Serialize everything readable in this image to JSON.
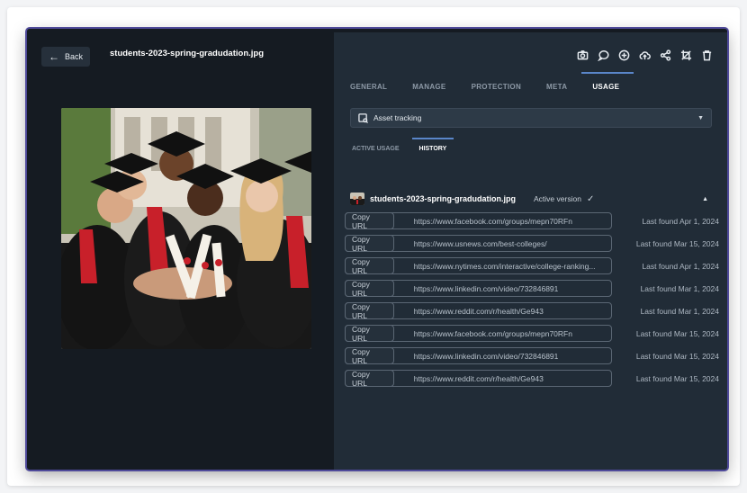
{
  "header": {
    "back_label": "Back",
    "file_name": "students-2023-spring-gradudation.jpg"
  },
  "toolbar": {
    "icons": [
      "camera-icon",
      "comment-icon",
      "add-circle-icon",
      "cloud-upload-icon",
      "share-icon",
      "crop-icon",
      "trash-icon"
    ]
  },
  "tabs": [
    {
      "label": "GENERAL",
      "active": false
    },
    {
      "label": "MANAGE",
      "active": false
    },
    {
      "label": "PROTECTION",
      "active": false
    },
    {
      "label": "META",
      "active": false
    },
    {
      "label": "USAGE",
      "active": true
    }
  ],
  "select": {
    "value": "Asset tracking"
  },
  "subtabs": [
    {
      "label": "ACTIVE USAGE",
      "active": false
    },
    {
      "label": "HISTORY",
      "active": true
    }
  ],
  "version": {
    "name": "students-2023-spring-gradudation.jpg",
    "status": "Active version"
  },
  "usage_rows": [
    {
      "copy_label": "Copy URL",
      "url": "https://www.facebook.com/groups/mepn70RFn",
      "found": "Last found Apr 1, 2024"
    },
    {
      "copy_label": "Copy URL",
      "url": "https://www.usnews.com/best-colleges/",
      "found": "Last found Mar 15, 2024"
    },
    {
      "copy_label": "Copy URL",
      "url": "https://www.nytimes.com/interactive/college-ranking...",
      "found": "Last found Apr 1, 2024"
    },
    {
      "copy_label": "Copy URL",
      "url": "https://www.linkedin.com/video/732846891",
      "found": "Last found Mar 1, 2024"
    },
    {
      "copy_label": "Copy URL",
      "url": "https://www.reddit.com/r/health/Ge943",
      "found": "Last found Mar 1, 2024"
    },
    {
      "copy_label": "Copy URL",
      "url": "https://www.facebook.com/groups/mepn70RFn",
      "found": "Last found Mar 15, 2024"
    },
    {
      "copy_label": "Copy URL",
      "url": "https://www.linkedin.com/video/732846891",
      "found": "Last found Mar 15, 2024"
    },
    {
      "copy_label": "Copy URL",
      "url": "https://www.reddit.com/r/health/Ge943",
      "found": "Last found Mar 15, 2024"
    }
  ],
  "colors": {
    "panel_dark": "#151b22",
    "panel": "#212c37",
    "accent": "#5a86c9",
    "frame": "#4f4a9a"
  }
}
